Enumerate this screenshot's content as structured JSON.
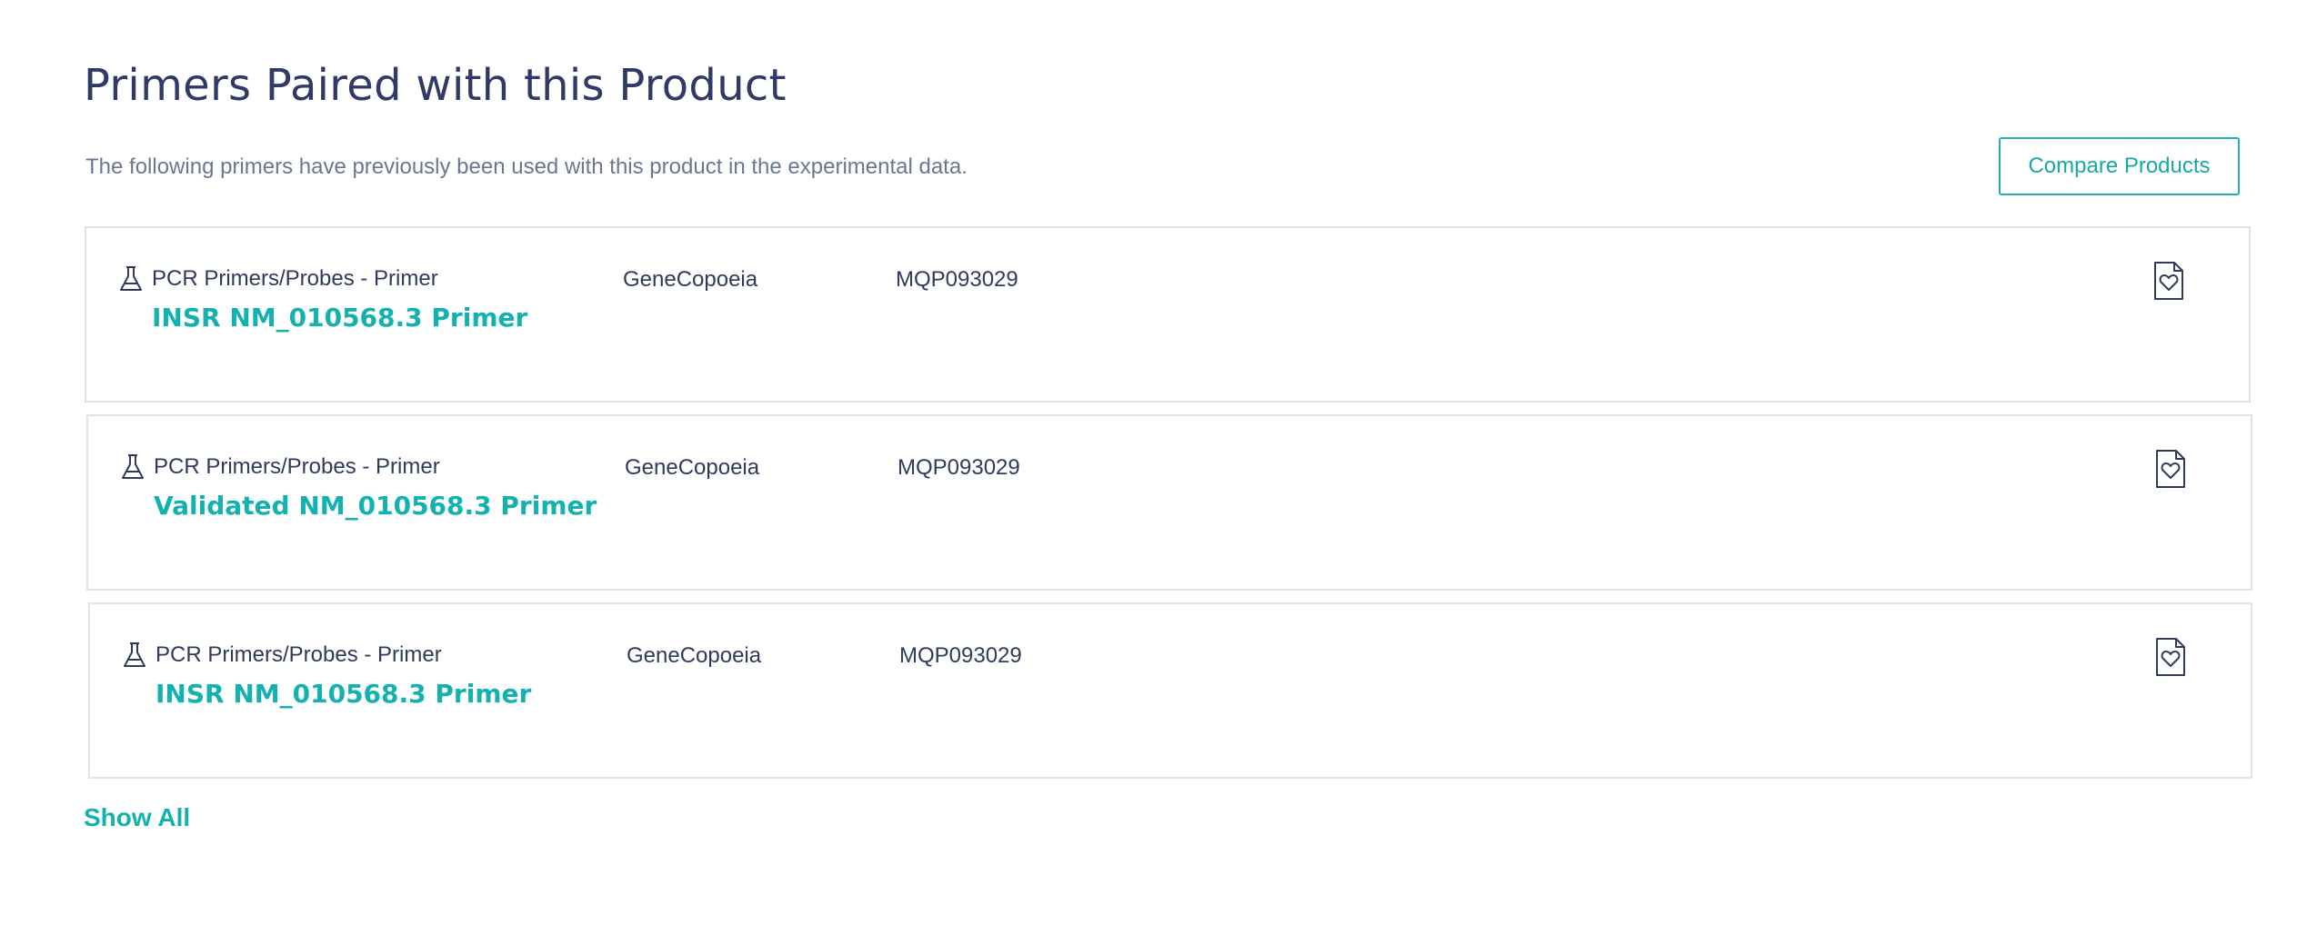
{
  "section": {
    "title": "Primers Paired with this Product",
    "subtitle": "The following primers have previously been used with this product in the experimental data.",
    "compare_button": "Compare Products",
    "show_all": "Show All"
  },
  "colors": {
    "accent": "#14b1b1",
    "text": "#2f3b5c",
    "muted": "#6b7691",
    "border": "#dfe2ea"
  },
  "items": [
    {
      "category": "PCR Primers/Probes - Primer",
      "name": "INSR NM_010568.3 Primer",
      "vendor": "GeneCopoeia",
      "catalog_number": "MQP093029",
      "category_icon": "flask-icon",
      "action_icon": "document-heart-icon"
    },
    {
      "category": "PCR Primers/Probes - Primer",
      "name": "Validated NM_010568.3 Primer",
      "vendor": "GeneCopoeia",
      "catalog_number": "MQP093029",
      "category_icon": "flask-icon",
      "action_icon": "document-heart-icon"
    },
    {
      "category": "PCR Primers/Probes - Primer",
      "name": "INSR NM_010568.3 Primer",
      "vendor": "GeneCopoeia",
      "catalog_number": "MQP093029",
      "category_icon": "flask-icon",
      "action_icon": "document-heart-icon"
    }
  ]
}
